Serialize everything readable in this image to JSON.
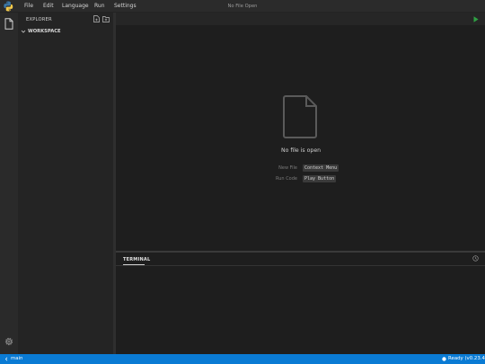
{
  "menubar": {
    "items": [
      "File",
      "Edit",
      "Language",
      "Run",
      "Settings"
    ],
    "title": "No File Open",
    "logo_icon": "python-logo-icon"
  },
  "activity_bar": {
    "top_icon": "files-icon",
    "bottom_icon": "gear-icon"
  },
  "sidebar": {
    "header": "EXPLORER",
    "actions": [
      "new-file-icon",
      "new-folder-icon"
    ],
    "workspace_label": "WORKSPACE"
  },
  "editor": {
    "run_icon": "play-icon",
    "empty_message": "No file is open",
    "hints": [
      {
        "label": "New File",
        "key": "Context Menu"
      },
      {
        "label": "Run Code",
        "key": "Play Button"
      }
    ]
  },
  "panel": {
    "tab": "TERMINAL",
    "action_icon": "history-icon"
  },
  "statusbar": {
    "branch": "main",
    "status": "Ready (v0.23.4)",
    "background": "#0a7bd4"
  },
  "colors": {
    "run_green": "#2ea043",
    "accent_blue": "#0a7bd4"
  }
}
